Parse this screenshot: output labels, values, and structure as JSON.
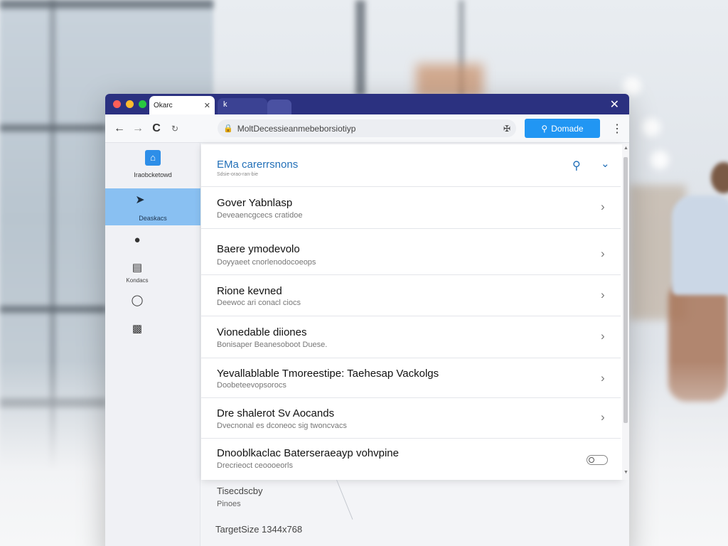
{
  "browser": {
    "tab_active_title": "Okarc",
    "tab_second_label": "k",
    "address": "MoltDecessieanmebeborsiotiyp",
    "search_button_label": "Domade"
  },
  "sidebar": {
    "brand_name": "Iraobcketowd",
    "active_item_label": "Deaskacs",
    "items": [
      {
        "icon": "pin-icon",
        "label": ""
      },
      {
        "icon": "document-icon",
        "label": "Kondacs"
      },
      {
        "icon": "chat-icon",
        "label": ""
      },
      {
        "icon": "card-icon",
        "label": ""
      }
    ]
  },
  "main": {
    "title": "EMa carerrsnons",
    "subtitle": "Sdsie-orao-ran-bie",
    "rows": [
      {
        "title": "Gover Yabnlasp",
        "description": "Deveaencgcecs cratidoe",
        "control": "chevron"
      },
      {
        "title": "Baere ymodevolo",
        "description": "Doyyaeet cnorlenodocoeops",
        "control": "chevron"
      },
      {
        "title": "Rione kevned",
        "description": "Deewoc ari conacl ciocs",
        "control": "chevron"
      },
      {
        "title": "Vionedable diiones",
        "description": "Bonisaper Beanesoboot Duese.",
        "control": "chevron"
      },
      {
        "title": "Yevallablable Tmoreestipe: Taehesap Vackolgs",
        "description": "Doobeteevopsorocs",
        "control": "chevron"
      },
      {
        "title": "Dre shalerot Sv Aocands",
        "description": "Dvecnonal es dconeoc sig twoncvacs",
        "control": "chevron"
      },
      {
        "title": "Dnooblkaclac Baterseraeayp vohvpine",
        "description": "Drecrieoct ceoooeorls",
        "control": "toggle"
      }
    ],
    "below_title": "Tisecdscby",
    "below_subtitle": "Pinoes",
    "target_size_text": "TargetSize 1344x768"
  },
  "colors": {
    "tabbar": "#2b3180",
    "accent": "#2196f3",
    "sidebar_active": "#89c0f2",
    "title_blue": "#2370b8"
  }
}
